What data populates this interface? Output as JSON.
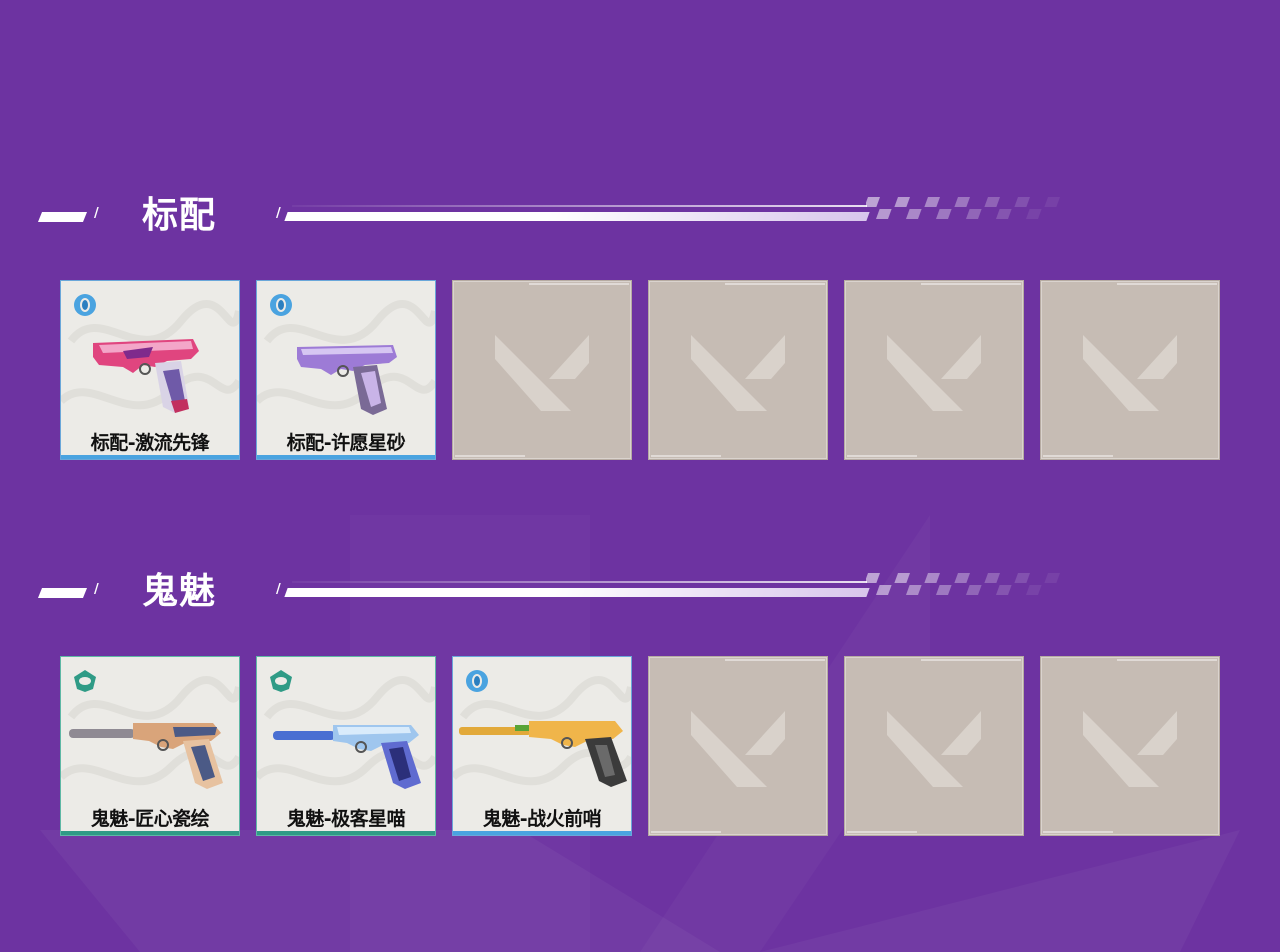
{
  "colors": {
    "background": "#6d33a1",
    "select_tier": "#4aa3e0",
    "deluxe_tier": "#2f9b86",
    "empty_slot": "#c6bcb4"
  },
  "sections": [
    {
      "title": "标配",
      "slots": [
        {
          "type": "skin",
          "label": "标配-激流先锋",
          "tier_icon": "select-tier-icon",
          "tier_color": "#4aa3e0",
          "weapon_icon": "classic-pistol-flux-icon"
        },
        {
          "type": "skin",
          "label": "标配-许愿星砂",
          "tier_icon": "select-tier-icon",
          "tier_color": "#4aa3e0",
          "weapon_icon": "classic-pistol-stardust-icon"
        },
        {
          "type": "empty"
        },
        {
          "type": "empty"
        },
        {
          "type": "empty"
        },
        {
          "type": "empty"
        }
      ]
    },
    {
      "title": "鬼魅",
      "slots": [
        {
          "type": "skin",
          "label": "鬼魅-匠心瓷绘",
          "tier_icon": "deluxe-tier-icon",
          "tier_color": "#2f9b86",
          "weapon_icon": "ghost-pistol-porcelain-icon"
        },
        {
          "type": "skin",
          "label": "鬼魅-极客星喵",
          "tier_icon": "deluxe-tier-icon",
          "tier_color": "#2f9b86",
          "weapon_icon": "ghost-pistol-blue-icon"
        },
        {
          "type": "skin",
          "label": "鬼魅-战火前哨",
          "tier_icon": "select-tier-icon",
          "tier_color": "#4aa3e0",
          "weapon_icon": "ghost-pistol-outpost-icon"
        },
        {
          "type": "empty"
        },
        {
          "type": "empty"
        },
        {
          "type": "empty"
        }
      ]
    }
  ]
}
